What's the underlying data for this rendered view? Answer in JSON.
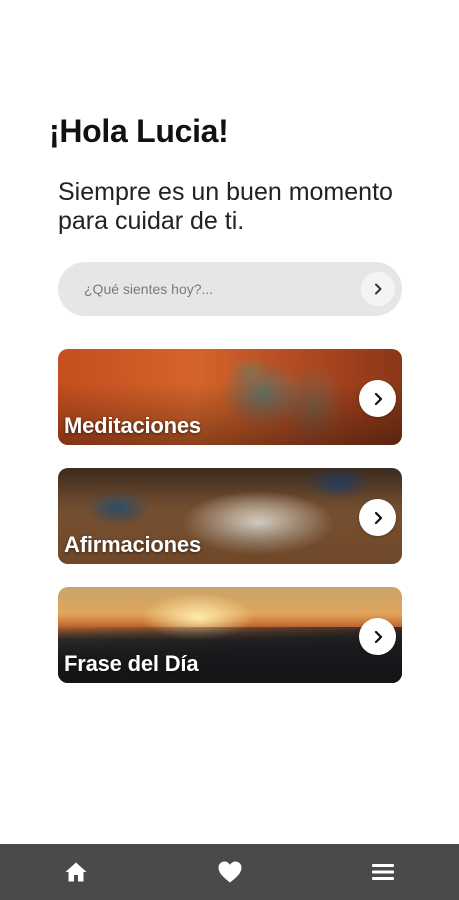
{
  "header": {
    "greeting": "¡Hola Lucia!",
    "subtitle": "Siempre es un buen momento para cuidar de ti."
  },
  "search": {
    "placeholder": "¿Qué sientes hoy?...",
    "value": "",
    "button_icon": "chevron-right-icon"
  },
  "cards": [
    {
      "title": "Meditaciones",
      "image": "buddha-statue-orange-background",
      "icon": "chevron-right-icon"
    },
    {
      "title": "Afirmaciones",
      "image": "notebook-glasses-on-desk",
      "icon": "chevron-right-icon"
    },
    {
      "title": "Frase del Día",
      "image": "sunset-over-mountains",
      "icon": "chevron-right-icon"
    }
  ],
  "bottom_nav": {
    "items": [
      {
        "icon": "home-icon"
      },
      {
        "icon": "heart-icon"
      },
      {
        "icon": "menu-icon"
      }
    ],
    "background": "#4a4a4a"
  },
  "colors": {
    "background": "#ffffff",
    "search_bg": "#e6e6e6",
    "card_title": "#ffffff"
  }
}
